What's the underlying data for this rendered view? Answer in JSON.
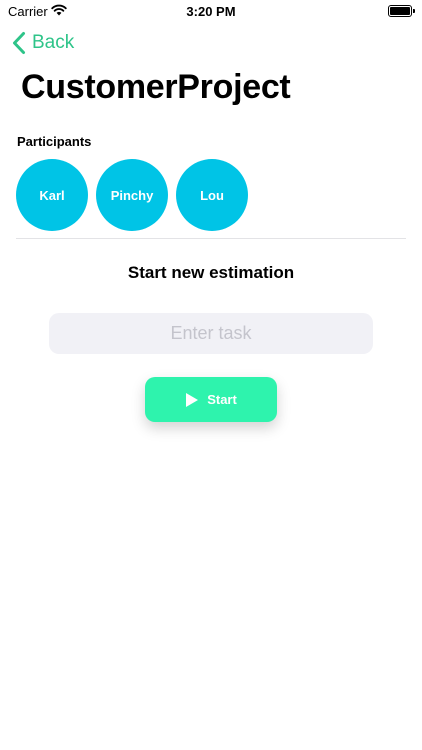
{
  "status_bar": {
    "carrier": "Carrier",
    "time": "3:20 PM",
    "wifi_icon": "wifi-icon",
    "battery_icon": "battery-icon"
  },
  "nav": {
    "back_label": "Back",
    "back_icon": "chevron-left-icon"
  },
  "page": {
    "title": "CustomerProject"
  },
  "participants": {
    "label": "Participants",
    "items": [
      {
        "name": "Karl"
      },
      {
        "name": "Pinchy"
      },
      {
        "name": "Lou"
      }
    ]
  },
  "estimation": {
    "heading": "Start new estimation",
    "task_placeholder": "Enter task",
    "task_value": "",
    "start_label": "Start",
    "start_icon": "play-icon"
  },
  "colors": {
    "accent": "#2ec489",
    "avatar": "#00c4e6",
    "start_button": "#2ef3ad",
    "input_bg": "#f1f1f6"
  }
}
